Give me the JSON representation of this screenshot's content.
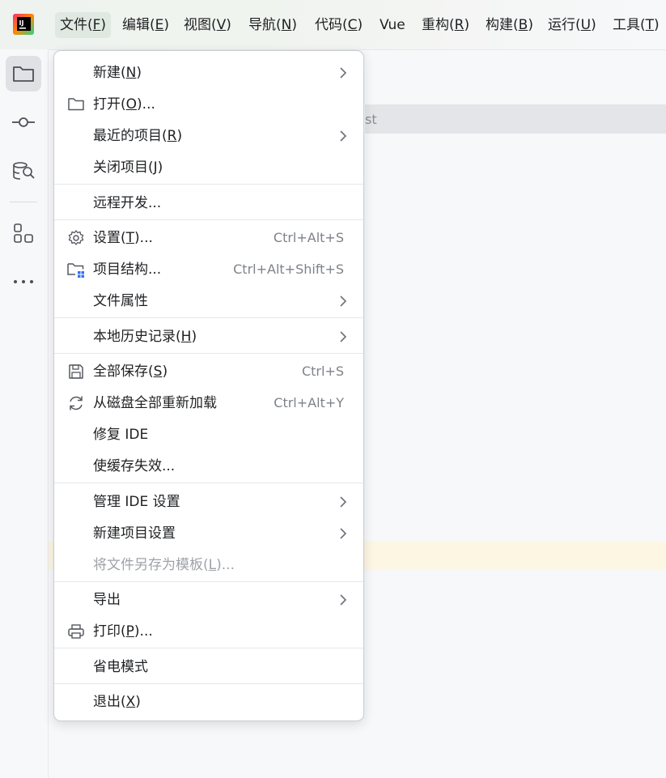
{
  "menubar": {
    "items": [
      {
        "label": "文件(",
        "mnemonic": "F",
        "suffix": ")"
      },
      {
        "label": "编辑(",
        "mnemonic": "E",
        "suffix": ")"
      },
      {
        "label": "视图(",
        "mnemonic": "V",
        "suffix": ")"
      },
      {
        "label": "导航(",
        "mnemonic": "N",
        "suffix": ")"
      },
      {
        "label": "代码(",
        "mnemonic": "C",
        "suffix": ")"
      },
      {
        "label": "Vue",
        "mnemonic": "",
        "suffix": ""
      },
      {
        "label": "重构(",
        "mnemonic": "R",
        "suffix": ")"
      },
      {
        "label": "构建(",
        "mnemonic": "B",
        "suffix": ")"
      },
      {
        "label": "运行(",
        "mnemonic": "U",
        "suffix": ")"
      },
      {
        "label": "工具(",
        "mnemonic": "T",
        "suffix": ")"
      }
    ]
  },
  "background": {
    "tab_text": "st"
  },
  "file_menu": {
    "items": [
      {
        "label": "新建(",
        "mnemonic": "N",
        "suffix": ")",
        "shortcut": "",
        "submenu": true,
        "icon": ""
      },
      {
        "label": "打开(",
        "mnemonic": "O",
        "suffix": ")...",
        "shortcut": "",
        "submenu": false,
        "icon": "folder-icon"
      },
      {
        "label": "最近的项目(",
        "mnemonic": "R",
        "suffix": ")",
        "shortcut": "",
        "submenu": true,
        "icon": ""
      },
      {
        "label": "关闭项目(",
        "mnemonic": "J",
        "suffix": ")",
        "shortcut": "",
        "submenu": false,
        "icon": ""
      },
      {
        "label": "远程开发...",
        "mnemonic": "",
        "suffix": "",
        "shortcut": "",
        "submenu": false,
        "icon": ""
      },
      {
        "label": "设置(",
        "mnemonic": "T",
        "suffix": ")...",
        "shortcut": "Ctrl+Alt+S",
        "submenu": false,
        "icon": "gear-icon"
      },
      {
        "label": "项目结构...",
        "mnemonic": "",
        "suffix": "",
        "shortcut": "Ctrl+Alt+Shift+S",
        "submenu": false,
        "icon": "project-structure-icon"
      },
      {
        "label": "文件属性",
        "mnemonic": "",
        "suffix": "",
        "shortcut": "",
        "submenu": true,
        "icon": ""
      },
      {
        "label": "本地历史记录(",
        "mnemonic": "H",
        "suffix": ")",
        "shortcut": "",
        "submenu": true,
        "icon": ""
      },
      {
        "label": "全部保存(",
        "mnemonic": "S",
        "suffix": ")",
        "shortcut": "Ctrl+S",
        "submenu": false,
        "icon": "save-icon"
      },
      {
        "label": "从磁盘全部重新加载",
        "mnemonic": "",
        "suffix": "",
        "shortcut": "Ctrl+Alt+Y",
        "submenu": false,
        "icon": "reload-icon"
      },
      {
        "label": "修复 IDE",
        "mnemonic": "",
        "suffix": "",
        "shortcut": "",
        "submenu": false,
        "icon": ""
      },
      {
        "label": "使缓存失效...",
        "mnemonic": "",
        "suffix": "",
        "shortcut": "",
        "submenu": false,
        "icon": ""
      },
      {
        "label": "管理 IDE 设置",
        "mnemonic": "",
        "suffix": "",
        "shortcut": "",
        "submenu": true,
        "icon": ""
      },
      {
        "label": "新建项目设置",
        "mnemonic": "",
        "suffix": "",
        "shortcut": "",
        "submenu": true,
        "icon": ""
      },
      {
        "label": "将文件另存为模板(",
        "mnemonic": "L",
        "suffix": ")...",
        "shortcut": "",
        "submenu": false,
        "icon": "",
        "disabled": true
      },
      {
        "label": "导出",
        "mnemonic": "",
        "suffix": "",
        "shortcut": "",
        "submenu": true,
        "icon": ""
      },
      {
        "label": "打印(",
        "mnemonic": "P",
        "suffix": ")...",
        "shortcut": "",
        "submenu": false,
        "icon": "printer-icon"
      },
      {
        "label": "省电模式",
        "mnemonic": "",
        "suffix": "",
        "shortcut": "",
        "submenu": false,
        "icon": ""
      },
      {
        "label": "退出(",
        "mnemonic": "X",
        "suffix": ")",
        "shortcut": "",
        "submenu": false,
        "icon": ""
      }
    ]
  },
  "colors": {
    "active_menu_bg": "#dfe9e1",
    "disabled_text": "#9fa2a8",
    "accent_blue": "#3574f0"
  }
}
